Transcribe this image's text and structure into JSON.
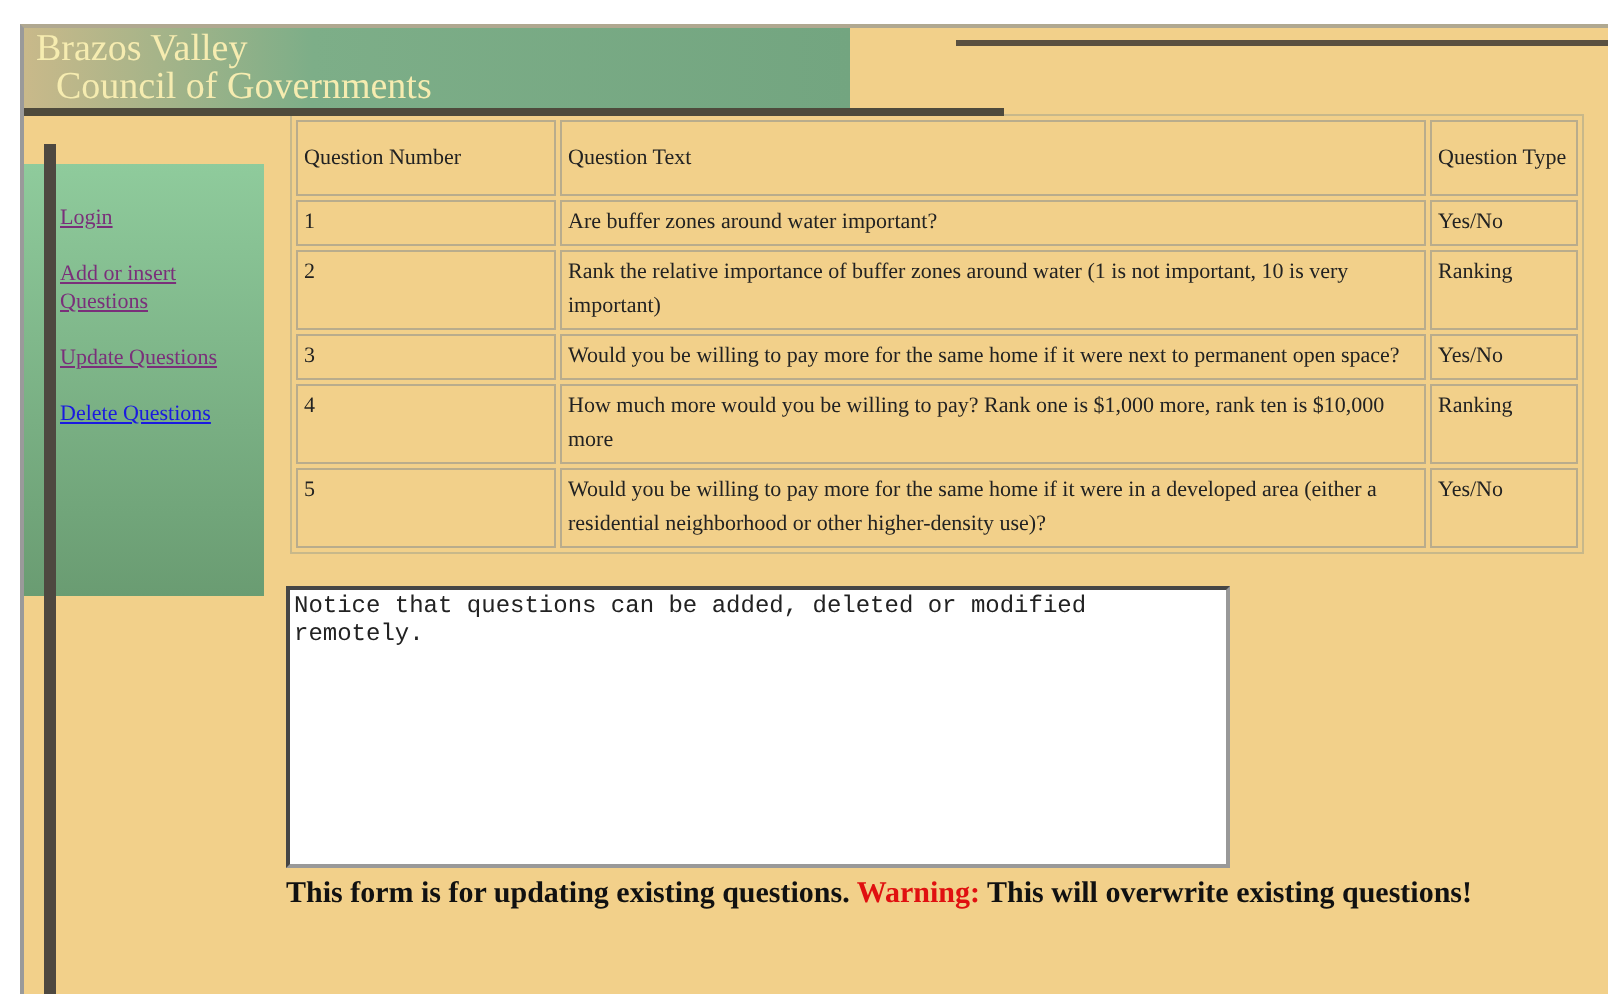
{
  "header": {
    "logo_line_1": "Brazos Valley",
    "logo_line_2": "Council of Governments"
  },
  "sidebar": {
    "links": [
      {
        "label": "Login",
        "visited": true
      },
      {
        "label": "Add or insert Questions",
        "visited": true
      },
      {
        "label": "Update Questions",
        "visited": true
      },
      {
        "label": "Delete Questions",
        "visited": false
      }
    ]
  },
  "table": {
    "columns": [
      "Question Number",
      "Question Text",
      "Question Type"
    ],
    "rows": [
      [
        "1",
        "Are buffer zones around water important?",
        "Yes/No"
      ],
      [
        "2",
        "Rank the relative importance of buffer zones around water (1 is not important, 10 is very important)",
        "Ranking"
      ],
      [
        "3",
        "Would you be willing to pay more for the same home if it were next to permanent open space?",
        "Yes/No"
      ],
      [
        "4",
        "How much more would you be willing to pay? Rank one is $1,000 more, rank ten is $10,000 more",
        "Ranking"
      ],
      [
        "5",
        "Would you be willing to pay more for the same home if it were in a developed area (either a residential neighborhood or other higher-density use)?",
        "Yes/No"
      ]
    ]
  },
  "editor": {
    "value": "Notice that questions can be added, deleted or modified remotely."
  },
  "note": {
    "text": "This form is for updating existing questions.",
    "warning_label": "Warning:",
    "warning_text": "This will overwrite existing questions!"
  }
}
